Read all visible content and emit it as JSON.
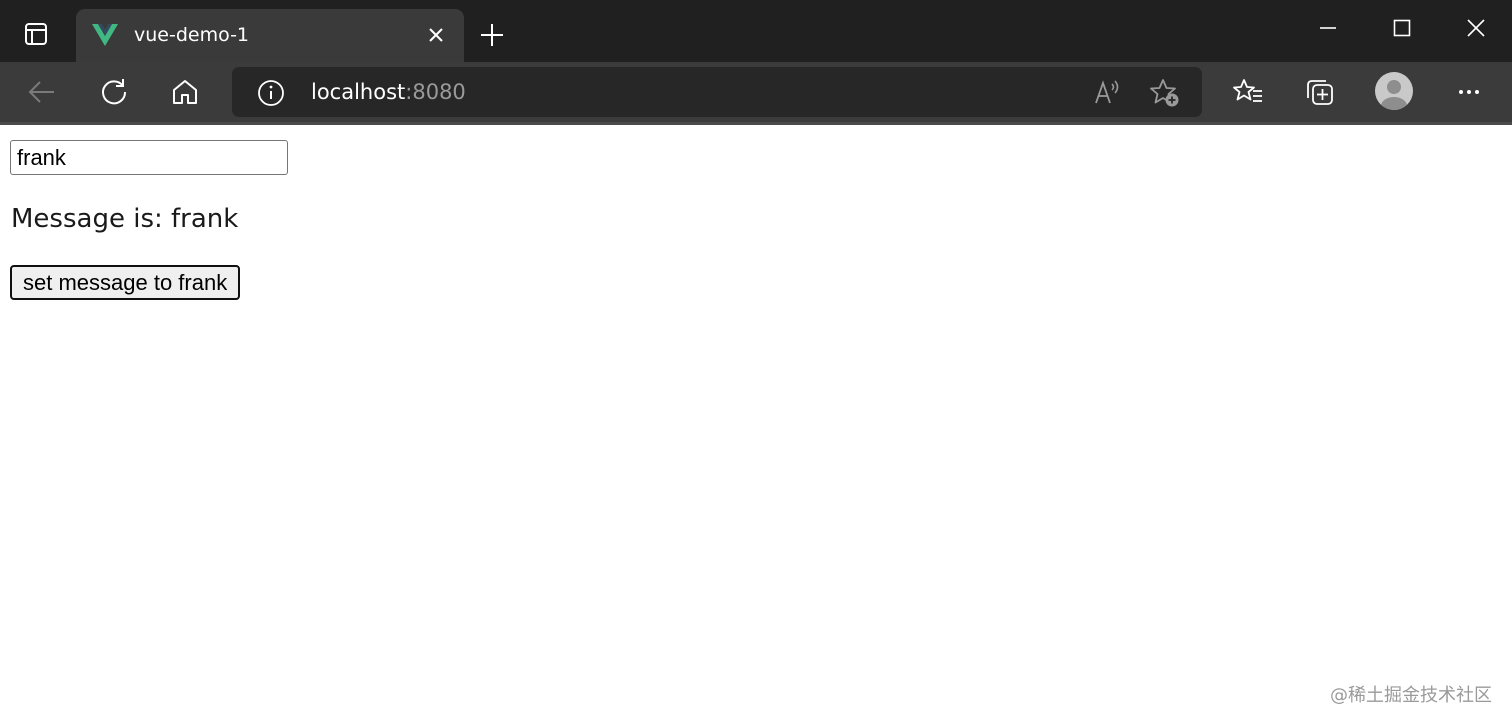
{
  "browser": {
    "tab": {
      "title": "vue-demo-1",
      "favicon": "vue-logo-icon",
      "favicon_colors": {
        "outer": "#41b883",
        "inner": "#35495e"
      }
    },
    "window_controls": [
      "minimize-icon",
      "maximize-icon",
      "close-icon"
    ],
    "address": {
      "host": "localhost",
      "port": ":8080"
    },
    "toolbar_icons": [
      "back-arrow-icon",
      "refresh-icon",
      "home-icon",
      "site-info-icon",
      "read-aloud-icon",
      "add-favorite-icon",
      "favorites-icon",
      "collections-icon",
      "profile-avatar",
      "more-icon"
    ],
    "colors": {
      "tabbar_bg": "#202020",
      "active_tab_bg": "#3a3a3a",
      "toolbar_bg": "#3b3b3b",
      "addressbar_bg": "#272727"
    }
  },
  "page": {
    "input_value": "frank",
    "message_line": "Message is: frank",
    "button_label": "set message to frank"
  },
  "watermark": "@稀土掘金技术社区"
}
